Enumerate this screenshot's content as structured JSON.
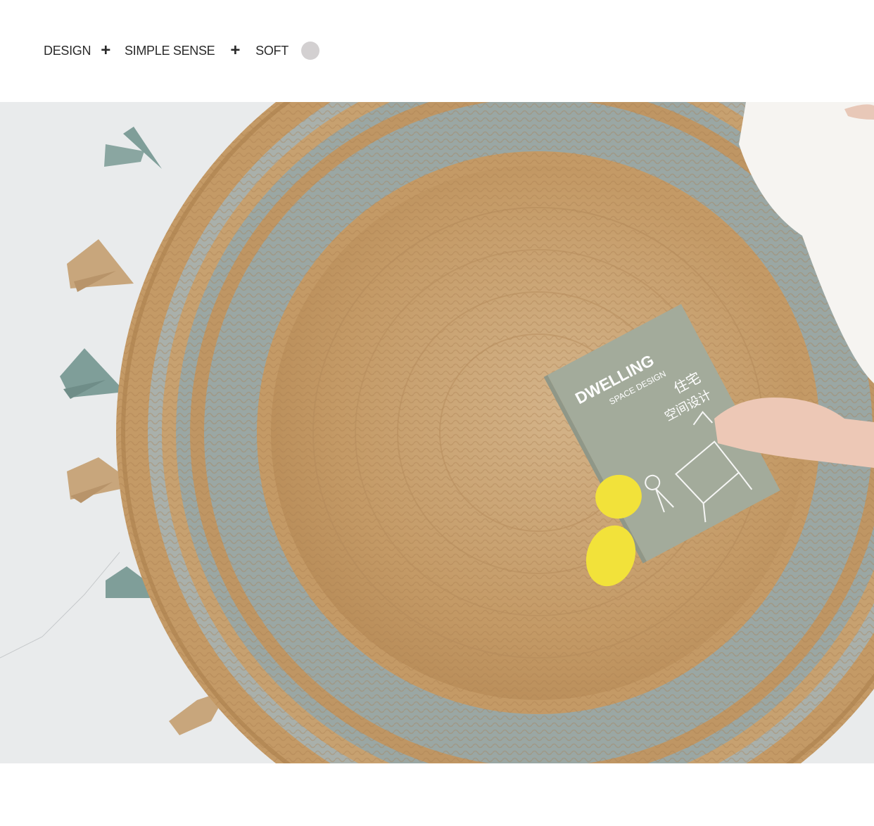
{
  "tagline": {
    "items": [
      "DESIGN",
      "SIMPLE SENSE",
      "SOFT"
    ],
    "separator": "+",
    "dot_color": "#d3d0d1"
  },
  "photo": {
    "book": {
      "title": "DWELLING",
      "subtitle": "SPACE DESIGN",
      "title_cn_1": "住宅",
      "title_cn_2": "空间设计"
    },
    "colors": {
      "jute": "#c49a66",
      "grey_stripe": "#9aa7a4",
      "tassel_green": "#7f9e99",
      "tassel_jute": "#c8a67c",
      "book_cover": "#a3ab9b",
      "lemon": "#f2e23a"
    }
  }
}
